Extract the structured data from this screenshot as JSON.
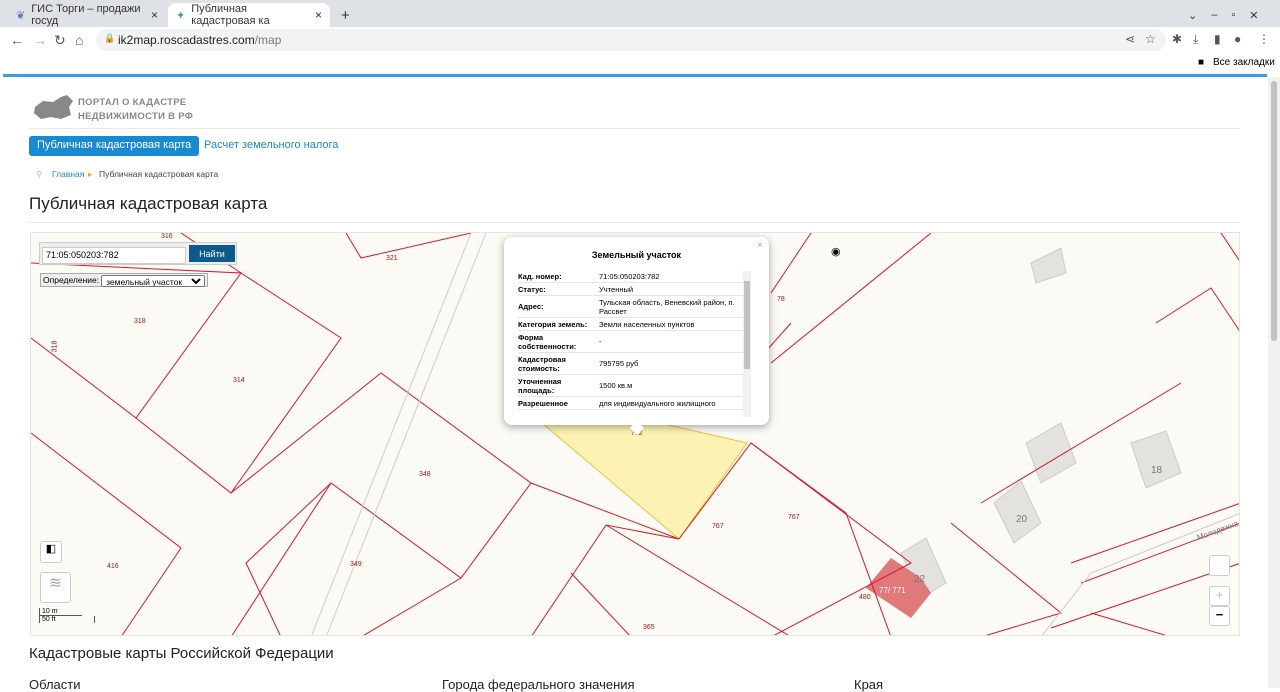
{
  "browser": {
    "tabs": [
      {
        "title": "ГИС Торги – продажи госуд"
      },
      {
        "title": "Публичная кадастровая ка"
      }
    ],
    "url_host": "ik2map.roscadastres.com",
    "url_path": "/map",
    "bookmarks": "Все закладки"
  },
  "site": {
    "logo_line1": "ПОРТАЛ О КАДАСТРЕ",
    "logo_line2": "НЕДВИЖИМОСТИ В РФ",
    "nav": [
      "Публичная кадастровая карта",
      "Расчет земельного налога"
    ],
    "breadcrumb": {
      "home": "Главная",
      "current": "Публичная кадастровая карта"
    },
    "title": "Публичная кадастровая карта"
  },
  "map": {
    "search_value": "71:05:050203:782",
    "search_button": "Найти",
    "definition_label": "Определение:",
    "definition_value": "земельный участок",
    "scale": [
      "10 m",
      "50 ft"
    ],
    "parcels": [
      "316",
      "321",
      "318",
      "318",
      "314",
      "348",
      "349",
      "416",
      "365",
      "762",
      "767",
      "767",
      "78",
      "480"
    ],
    "buildings": [
      "18",
      "20",
      "22",
      "77/ 771"
    ],
    "street": "Молодежна",
    "popup": {
      "title": "Земельный участок",
      "rows": [
        {
          "k": "Кад. номер:",
          "v": "71:05:050203:782"
        },
        {
          "k": "Статус:",
          "v": "Учтенный"
        },
        {
          "k": "Адрес:",
          "v": "Тульская область, Веневский район, п. Рассвет"
        },
        {
          "k": "Категория земель:",
          "v": "Земли населенных пунктов"
        },
        {
          "k": "Форма собственности:",
          "v": "-"
        },
        {
          "k": "Кадастровая стоимость:",
          "v": "795795 руб"
        },
        {
          "k": "Уточненная площадь:",
          "v": "1500 кв.м"
        },
        {
          "k": "Разрешенное",
          "v": "для индивидуального жилищного"
        }
      ]
    },
    "zoom_in": "+",
    "zoom_out": "−"
  },
  "footer": {
    "heading": "Кадастровые карты Российской Федерации",
    "columns": [
      "Области",
      "Города федерального значения",
      "Края"
    ]
  },
  "colors": {
    "accent": "#1a8ad0",
    "parcel_line": "#d7192a",
    "selected_parcel": "#fbf2b3"
  }
}
